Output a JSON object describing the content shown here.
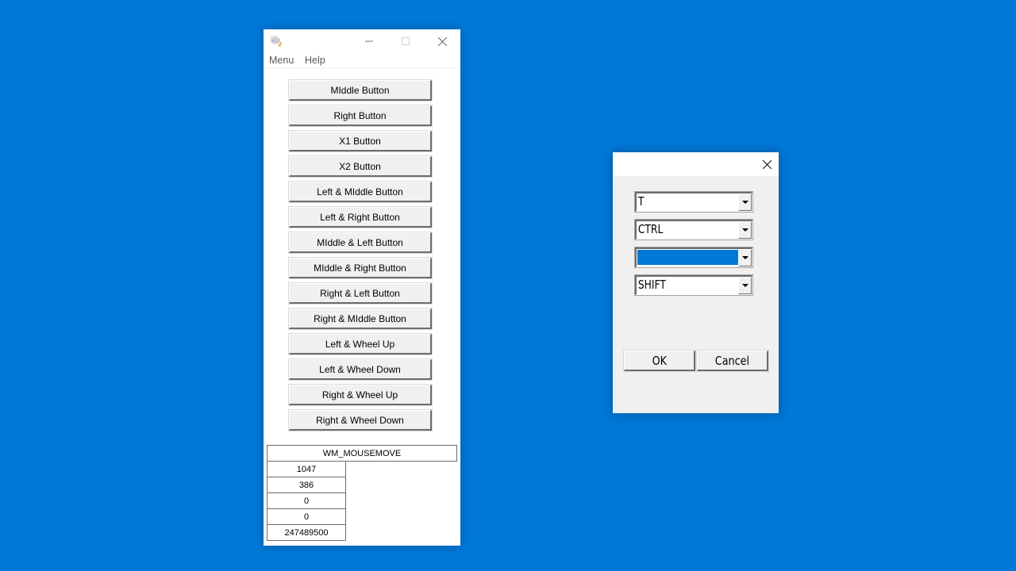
{
  "main_window": {
    "icon": "mouse-app-icon",
    "title_buttons": {
      "minimize": "minimize-icon",
      "maximize": "maximize-icon",
      "close": "close-icon"
    },
    "menu": [
      {
        "label": "Menu"
      },
      {
        "label": "Help"
      }
    ],
    "buttons": [
      {
        "label": "MIddle Button"
      },
      {
        "label": "Right Button"
      },
      {
        "label": "X1 Button"
      },
      {
        "label": "X2 Button"
      },
      {
        "label": "Left & MIddle Button"
      },
      {
        "label": "Left & Right Button"
      },
      {
        "label": "MIddle & Left Button"
      },
      {
        "label": "MIddle & Right Button"
      },
      {
        "label": "Right & Left Button"
      },
      {
        "label": "Right & MIddle Button"
      },
      {
        "label": "Left & Wheel Up"
      },
      {
        "label": "Left & Wheel Down"
      },
      {
        "label": "Right & Wheel Up"
      },
      {
        "label": "Right & Wheel Down"
      }
    ],
    "message_panel": {
      "header": "WM_MOUSEMOVE",
      "values": [
        "1047",
        "386",
        "0",
        "0",
        "247489500"
      ]
    }
  },
  "dialog": {
    "close": "close-icon",
    "combos": [
      {
        "value": "T",
        "highlighted": false
      },
      {
        "value": "CTRL",
        "highlighted": false
      },
      {
        "value": "",
        "highlighted": true
      },
      {
        "value": "SHIFT",
        "highlighted": false
      }
    ],
    "ok_label": "OK",
    "cancel_label": "Cancel"
  },
  "colors": {
    "desktop": "#0078d7",
    "selection": "#0078d7",
    "button_face": "#f0f0f0"
  }
}
